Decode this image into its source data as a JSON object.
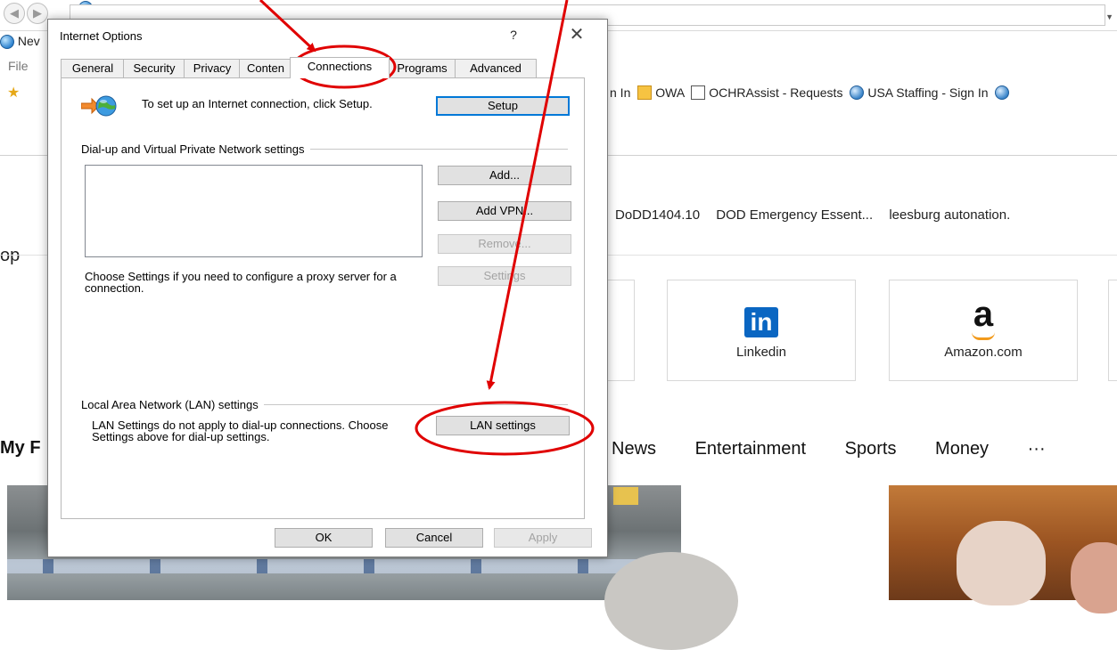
{
  "browser": {
    "tab_title": "Nev",
    "menu_file": "File",
    "favorites": [
      {
        "label": "n In",
        "icon": "none"
      },
      {
        "label": "OWA",
        "icon": "owa-icon"
      },
      {
        "label": "OCHRAssist - Requests",
        "icon": "document-icon"
      },
      {
        "label": "USA Staffing - Sign In",
        "icon": "ie-icon"
      }
    ],
    "links_row": [
      "DoDD1404.10",
      "DOD Emergency Essent...",
      "leesburg autonation."
    ],
    "section_top": "op",
    "tiles": [
      {
        "label": "Linkedin",
        "logo": "in"
      },
      {
        "label": "Amazon.com",
        "logo": "a"
      }
    ],
    "section_my": "My F",
    "categories": [
      "News",
      "Entertainment",
      "Sports",
      "Money",
      "···"
    ]
  },
  "dialog": {
    "title": "Internet Options",
    "help_glyph": "?",
    "close_glyph": "✕",
    "tabs": [
      "General",
      "Security",
      "Privacy",
      "Conten",
      "Connections",
      "Programs",
      "Advanced"
    ],
    "active_tab": "Connections",
    "setup_text": "To set up an Internet connection, click Setup.",
    "setup_button": "Setup",
    "dialup_section": "Dial-up and Virtual Private Network settings",
    "add_button": "Add...",
    "add_vpn_button": "Add VPN...",
    "remove_button": "Remove...",
    "settings_button": "Settings",
    "proxy_text": "Choose Settings if you need to configure a proxy server for a connection.",
    "lan_section": "Local Area Network (LAN) settings",
    "lan_text": "LAN Settings do not apply to dial-up connections. Choose Settings above for dial-up settings.",
    "lan_button": "LAN settings",
    "ok_button": "OK",
    "cancel_button": "Cancel",
    "apply_button": "Apply"
  },
  "colors": {
    "annotation": "#e00000",
    "focus": "#0078d7",
    "dialog_border": "#7b7b7b"
  }
}
